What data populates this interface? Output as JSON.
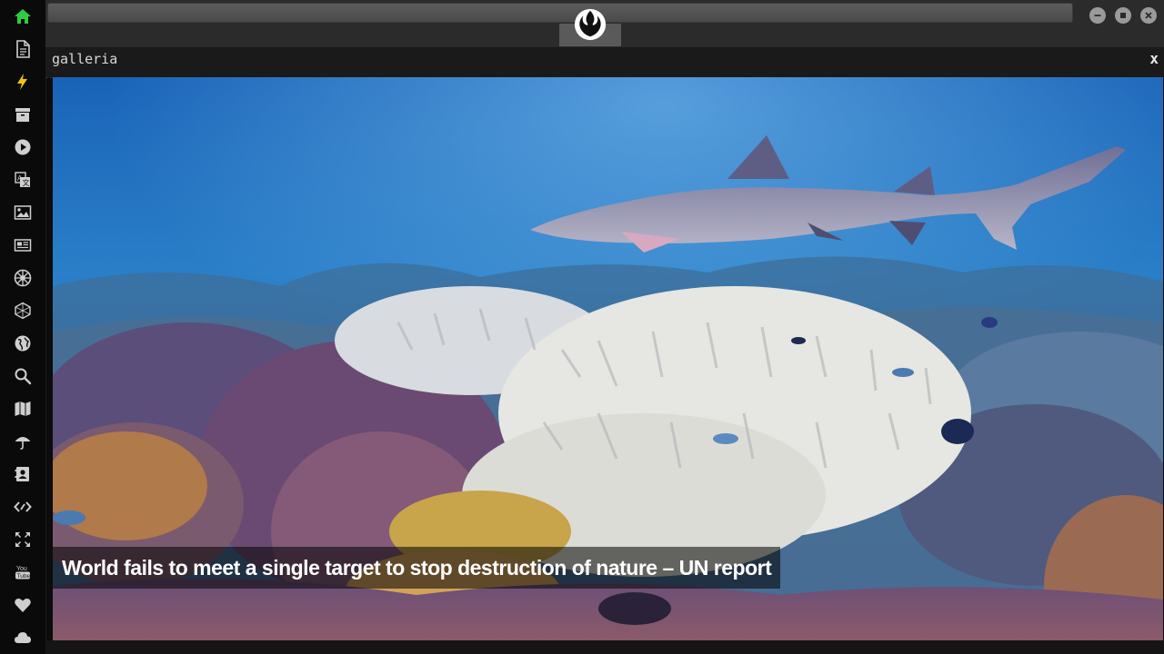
{
  "window": {
    "title": "galleria",
    "close_label": "x"
  },
  "sidebar": {
    "items": [
      {
        "name": "home-icon",
        "active": true
      },
      {
        "name": "document-icon"
      },
      {
        "name": "lightning-icon",
        "active": true
      },
      {
        "name": "archive-icon"
      },
      {
        "name": "play-icon"
      },
      {
        "name": "translate-icon"
      },
      {
        "name": "image-icon"
      },
      {
        "name": "newspaper-icon"
      },
      {
        "name": "galactic-empire-icon"
      },
      {
        "name": "cube-icon"
      },
      {
        "name": "globe-icon"
      },
      {
        "name": "search-icon"
      },
      {
        "name": "map-icon"
      },
      {
        "name": "umbrella-icon"
      },
      {
        "name": "contact-card-icon"
      },
      {
        "name": "code-icon"
      },
      {
        "name": "expand-icon"
      },
      {
        "name": "youtube-icon"
      },
      {
        "name": "heart-icon"
      },
      {
        "name": "cloud-icon"
      }
    ],
    "youtube_label": "You Tube"
  },
  "gallery": {
    "caption": "World fails to meet a single target to stop destruction of nature – UN report"
  },
  "colors": {
    "accent_active": "#2ecc40",
    "accent_lightning": "#f1c40f",
    "icon": "#cfcfcf"
  }
}
